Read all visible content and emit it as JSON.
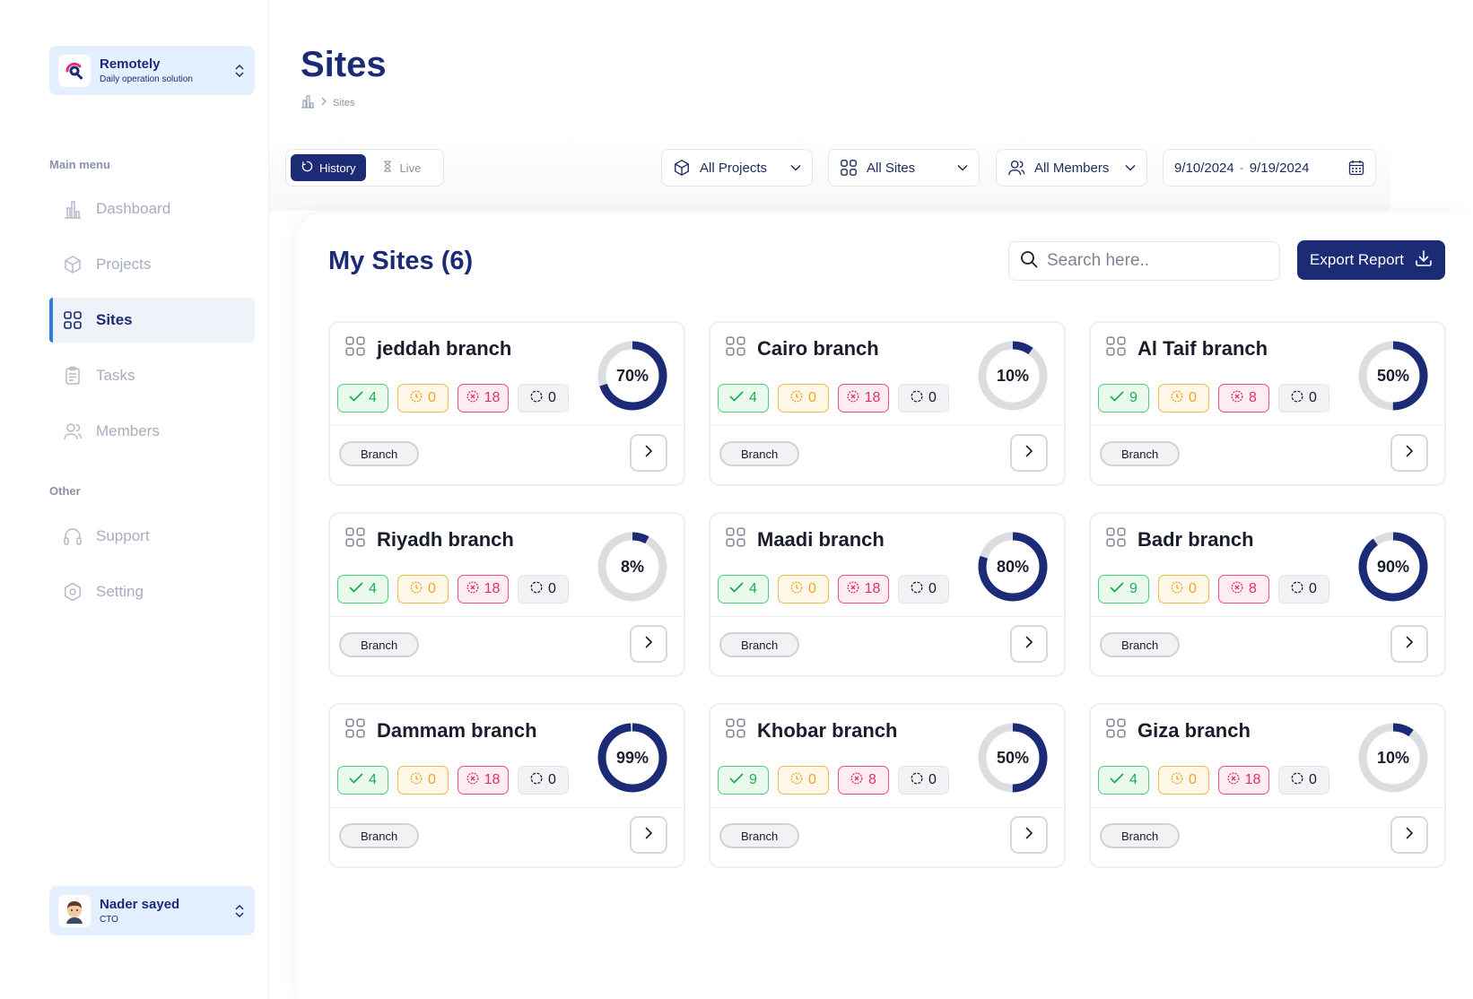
{
  "sidebar": {
    "org": {
      "name": "Remotely",
      "subtitle": "Daily operation solution"
    },
    "main_menu_label": "Main menu",
    "main_items": [
      {
        "label": "Dashboard",
        "icon": "chart-icon",
        "active": false
      },
      {
        "label": "Projects",
        "icon": "cube-icon",
        "active": false
      },
      {
        "label": "Sites",
        "icon": "grid-icon",
        "active": true
      },
      {
        "label": "Tasks",
        "icon": "clipboard-icon",
        "active": false
      },
      {
        "label": "Members",
        "icon": "users-icon",
        "active": false
      }
    ],
    "other_label": "Other",
    "other_items": [
      {
        "label": "Support",
        "icon": "headphones-icon"
      },
      {
        "label": "Setting",
        "icon": "settings-icon"
      }
    ],
    "user": {
      "name": "Nader sayed",
      "role": "CTO"
    }
  },
  "header": {
    "title": "Sites",
    "breadcrumb": [
      "Sites"
    ]
  },
  "toolbar": {
    "modes": [
      "History",
      "Live"
    ],
    "active_mode": "History",
    "projects_filter": "All Projects",
    "sites_filter": "All Sites",
    "members_filter": "All Members",
    "date_from": "9/10/2024",
    "date_to": "9/19/2024",
    "date_separator": "-"
  },
  "main": {
    "heading": "My Sites (6)",
    "search_placeholder": "Search here..",
    "export_label": "Export Report"
  },
  "colors": {
    "primary": "#1b2b75",
    "accent": "#2f7de1",
    "done": "#1fae53",
    "pending": "#f0a325",
    "failed": "#e1306c",
    "donut_track": "#dcdde1"
  },
  "sites": [
    {
      "name": "jeddah branch",
      "percent": 70,
      "percent_label": "70%",
      "done": "4",
      "pending": "0",
      "failed": "18",
      "none": "0",
      "tag": "Branch"
    },
    {
      "name": "Cairo branch",
      "percent": 10,
      "percent_label": "10%",
      "done": "4",
      "pending": "0",
      "failed": "18",
      "none": "0",
      "tag": "Branch"
    },
    {
      "name": "Al Taif branch",
      "percent": 50,
      "percent_label": "50%",
      "done": "9",
      "pending": "0",
      "failed": "8",
      "none": "0",
      "tag": "Branch"
    },
    {
      "name": "Riyadh branch",
      "percent": 8,
      "percent_label": "8%",
      "done": "4",
      "pending": "0",
      "failed": "18",
      "none": "0",
      "tag": "Branch"
    },
    {
      "name": "Maadi branch",
      "percent": 80,
      "percent_label": "80%",
      "done": "4",
      "pending": "0",
      "failed": "18",
      "none": "0",
      "tag": "Branch"
    },
    {
      "name": "Badr branch",
      "percent": 90,
      "percent_label": "90%",
      "done": "9",
      "pending": "0",
      "failed": "8",
      "none": "0",
      "tag": "Branch"
    },
    {
      "name": "Dammam branch",
      "percent": 99,
      "percent_label": "99%",
      "done": "4",
      "pending": "0",
      "failed": "18",
      "none": "0",
      "tag": "Branch"
    },
    {
      "name": "Khobar branch",
      "percent": 50,
      "percent_label": "50%",
      "done": "9",
      "pending": "0",
      "failed": "8",
      "none": "0",
      "tag": "Branch"
    },
    {
      "name": "Giza branch",
      "percent": 10,
      "percent_label": "10%",
      "done": "4",
      "pending": "0",
      "failed": "18",
      "none": "0",
      "tag": "Branch"
    }
  ]
}
